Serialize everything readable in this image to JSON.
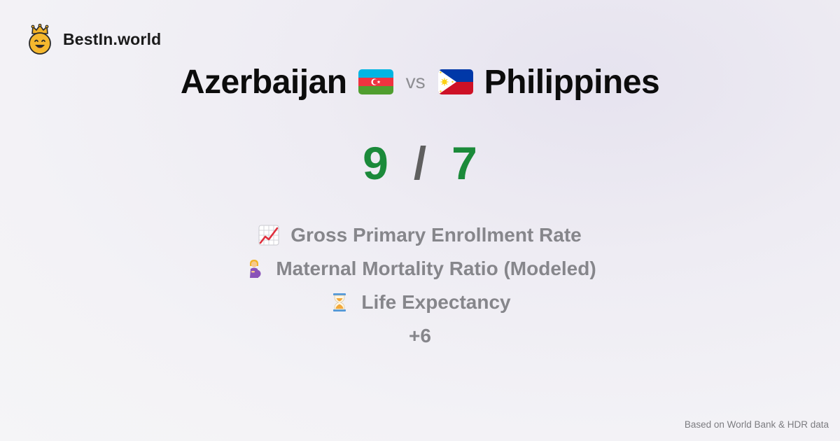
{
  "brand": {
    "name": "BestIn.world",
    "logo_icon": "crowned-smiley-icon",
    "accent": "#f5b82e"
  },
  "comparison": {
    "left": {
      "country": "Azerbaijan",
      "flag_icon": "azerbaijan-flag-icon",
      "score": "9"
    },
    "vs_label": "vs",
    "right": {
      "country": "Philippines",
      "flag_icon": "philippines-flag-icon",
      "score": "7"
    },
    "separator": "/",
    "score_color": "#1b8a3a"
  },
  "metrics": [
    {
      "icon": "chart-increasing-icon",
      "label": "Gross Primary Enrollment Rate"
    },
    {
      "icon": "pregnant-woman-icon",
      "label": "Maternal Mortality Ratio (Modeled)"
    },
    {
      "icon": "hourglass-icon",
      "label": "Life Expectancy"
    }
  ],
  "more_label": "+6",
  "footer": {
    "source": "Based on World Bank & HDR data"
  }
}
